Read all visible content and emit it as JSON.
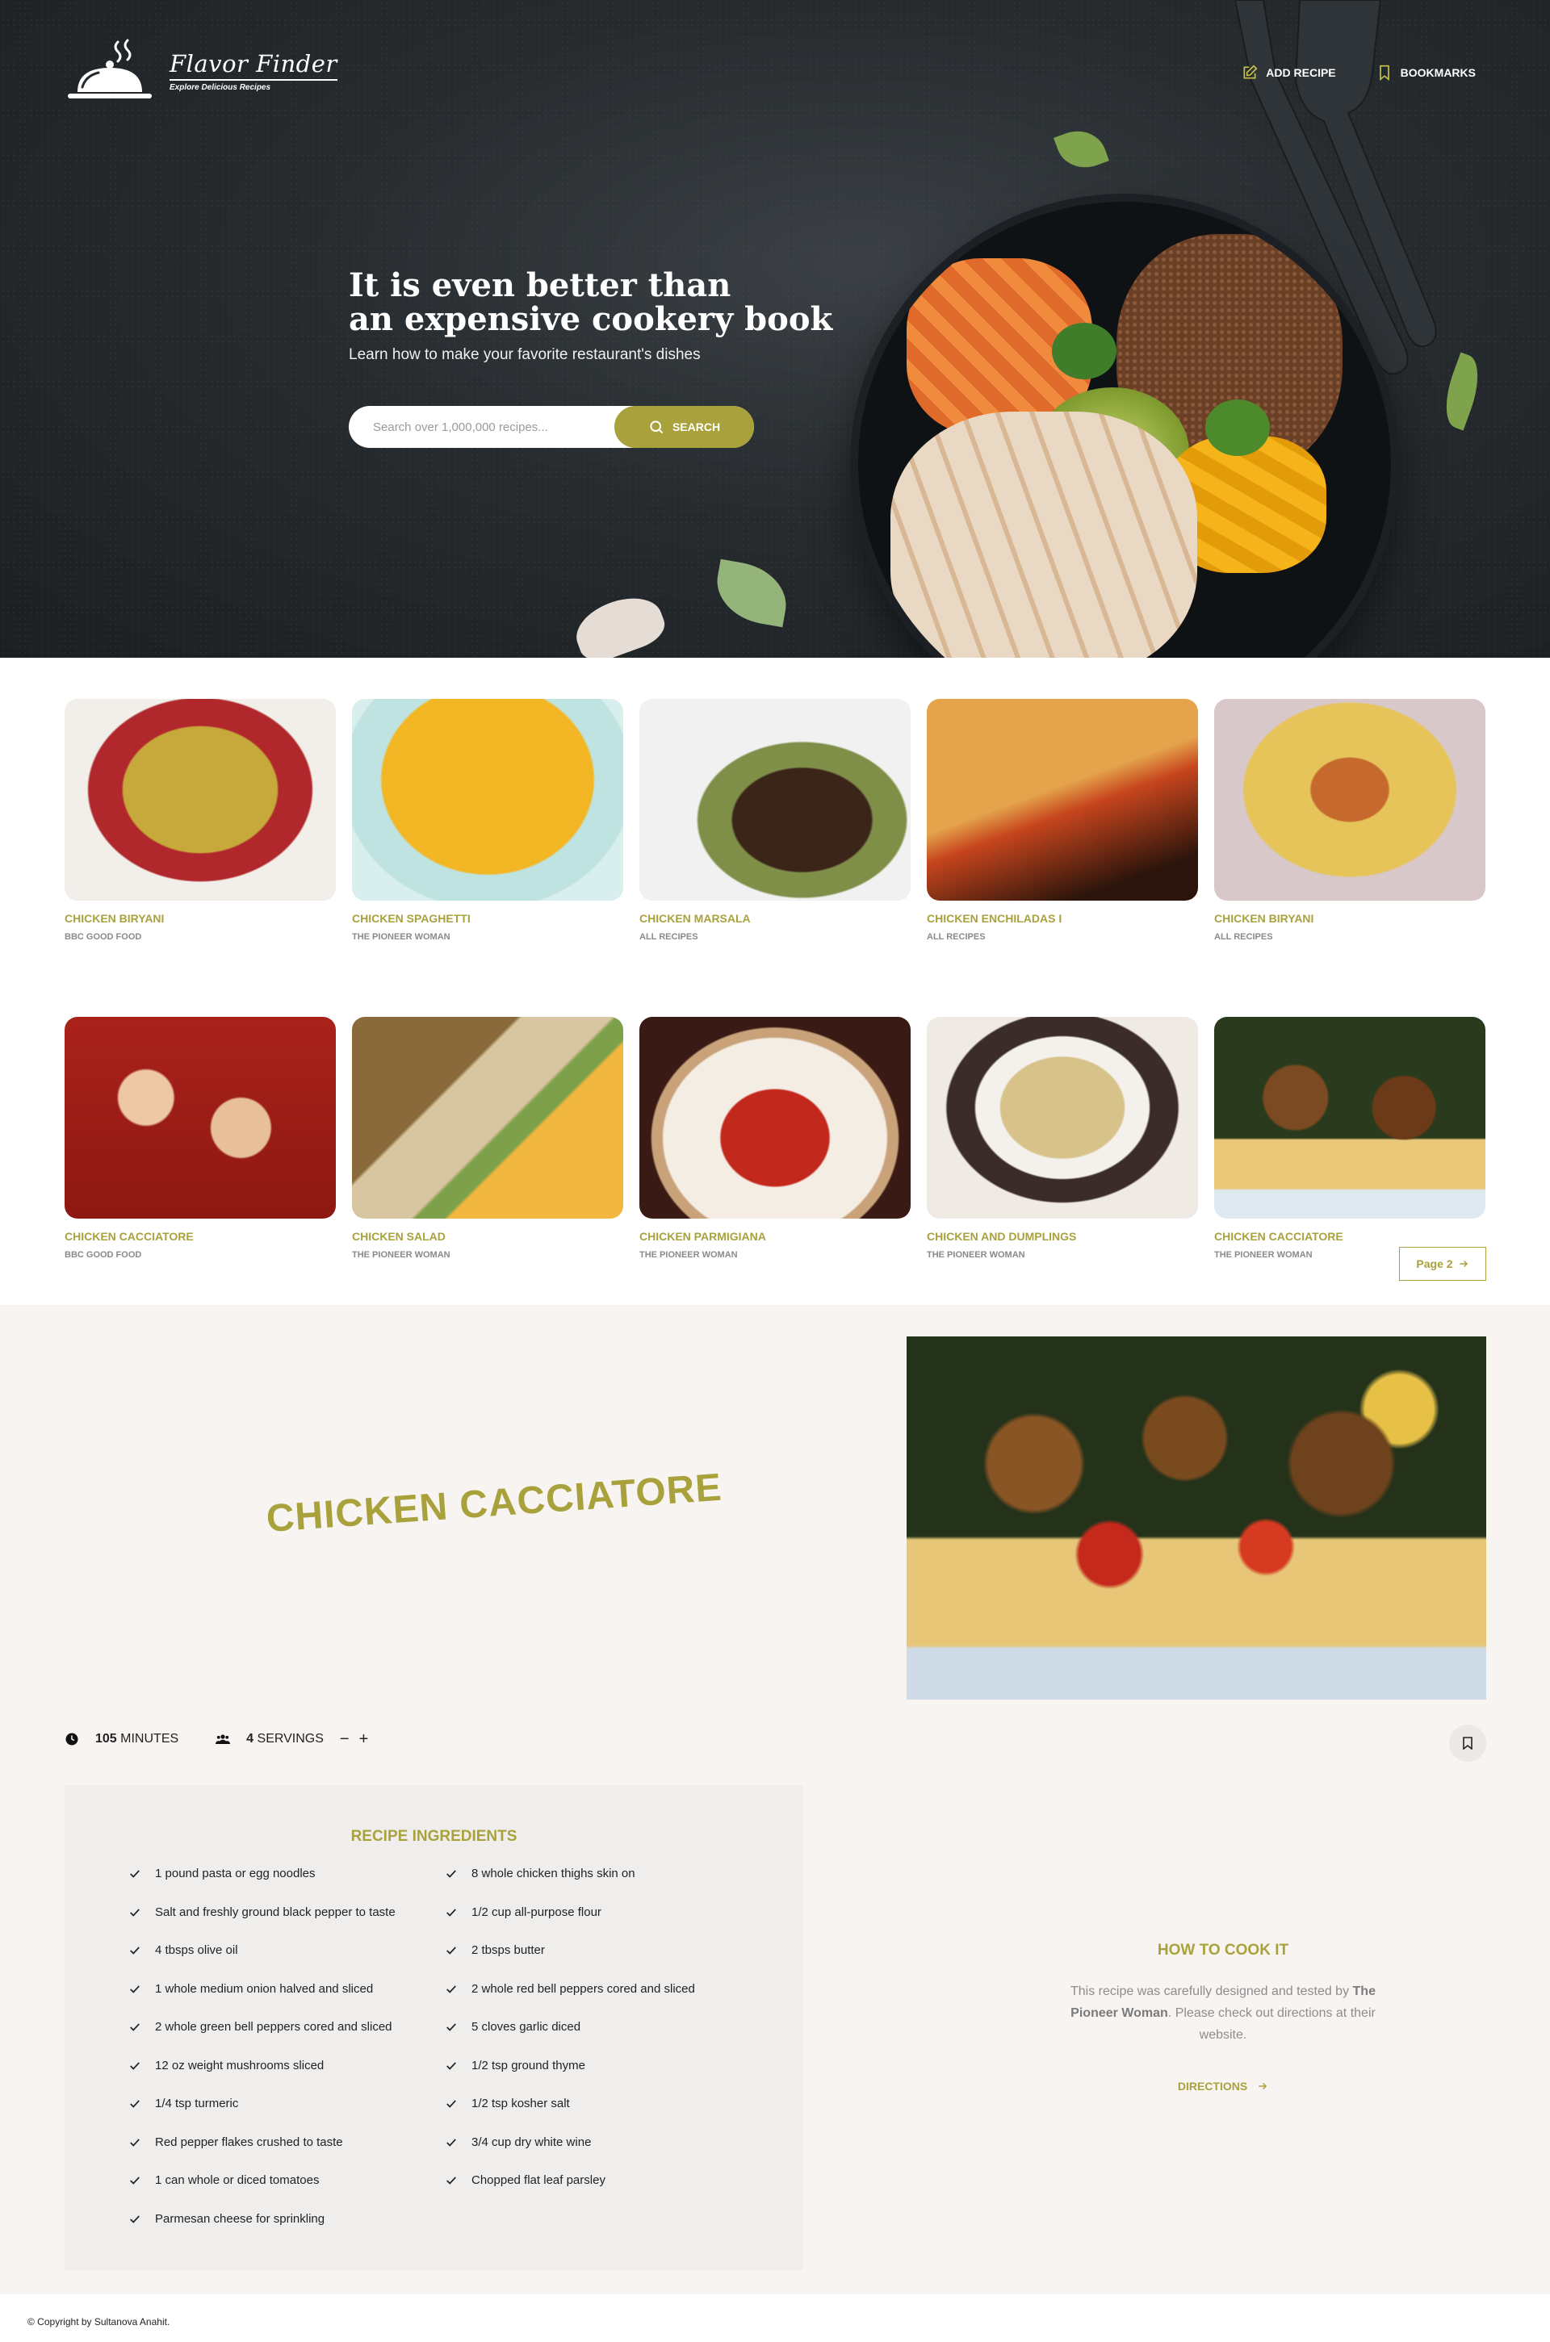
{
  "brand": {
    "name": "Flavor Finder",
    "tagline": "Explore Delicious Recipes"
  },
  "nav": {
    "add_recipe": "ADD RECIPE",
    "bookmarks": "BOOKMARKS"
  },
  "hero": {
    "title_line1": "It is even better than",
    "title_line2": "an expensive cookery book",
    "subtitle": "Learn how to make your favorite restaurant's dishes"
  },
  "search": {
    "placeholder": "Search over 1,000,000 recipes...",
    "button": "SEARCH"
  },
  "results": [
    {
      "title": "CHICKEN BIRYANI",
      "publisher": "BBC GOOD FOOD"
    },
    {
      "title": "CHICKEN SPAGHETTI",
      "publisher": "THE PIONEER WOMAN"
    },
    {
      "title": "CHICKEN MARSALA",
      "publisher": "ALL RECIPES"
    },
    {
      "title": "CHICKEN ENCHILADAS I",
      "publisher": "ALL RECIPES"
    },
    {
      "title": "CHICKEN BIRYANI",
      "publisher": "ALL RECIPES"
    },
    {
      "title": "CHICKEN CACCIATORE",
      "publisher": "BBC GOOD FOOD"
    },
    {
      "title": "CHICKEN SALAD",
      "publisher": "THE PIONEER WOMAN"
    },
    {
      "title": "CHICKEN PARMIGIANA",
      "publisher": "THE PIONEER WOMAN"
    },
    {
      "title": "CHICKEN AND DUMPLINGS",
      "publisher": "THE PIONEER WOMAN"
    },
    {
      "title": "CHICKEN CACCIATORE",
      "publisher": "THE PIONEER WOMAN"
    }
  ],
  "pagination": {
    "next_label": "Page 2"
  },
  "recipe": {
    "title": "CHICKEN CACCIATORE",
    "minutes": "105",
    "minutes_label": "MINUTES",
    "servings": "4",
    "servings_label": "SERVINGS",
    "decrease": "−",
    "increase": "+",
    "ingredients_title": "RECIPE INGREDIENTS",
    "ingredients": [
      "1 pound pasta or egg noodles",
      "8 whole chicken thighs skin on",
      "Salt and freshly ground black pepper to taste",
      "1/2 cup all-purpose flour",
      "4 tbsps olive oil",
      "2 tbsps butter",
      "1 whole medium onion halved and sliced",
      "2 whole red bell peppers cored and sliced",
      "2 whole green bell peppers cored and sliced",
      "5 cloves garlic diced",
      "12 oz weight mushrooms sliced",
      "1/2 tsp ground thyme",
      "1/4 tsp turmeric",
      "1/2 tsp kosher salt",
      "Red pepper flakes crushed to taste",
      "3/4 cup dry white wine",
      "1 can whole or diced tomatoes",
      "Chopped flat leaf parsley",
      "Parmesan cheese for sprinkling"
    ],
    "how_title": "HOW TO COOK IT",
    "how_text_before": "This recipe was carefully designed and tested by ",
    "how_publisher": "The Pioneer Woman",
    "how_text_after": ". Please check out directions at their website.",
    "directions": "DIRECTIONS"
  },
  "footer": {
    "copyright": "© Copyright by Sultanova Anahit."
  },
  "colors": {
    "accent": "#a9a23c",
    "hero_bg": "#262b2f",
    "detail_bg": "#f7f4f2",
    "ingredients_bg": "#f0eeec"
  },
  "icons": [
    "cloche-logo-icon",
    "edit-icon",
    "bookmark-icon",
    "search-icon",
    "arrow-right-icon",
    "clock-icon",
    "users-icon",
    "check-icon"
  ]
}
